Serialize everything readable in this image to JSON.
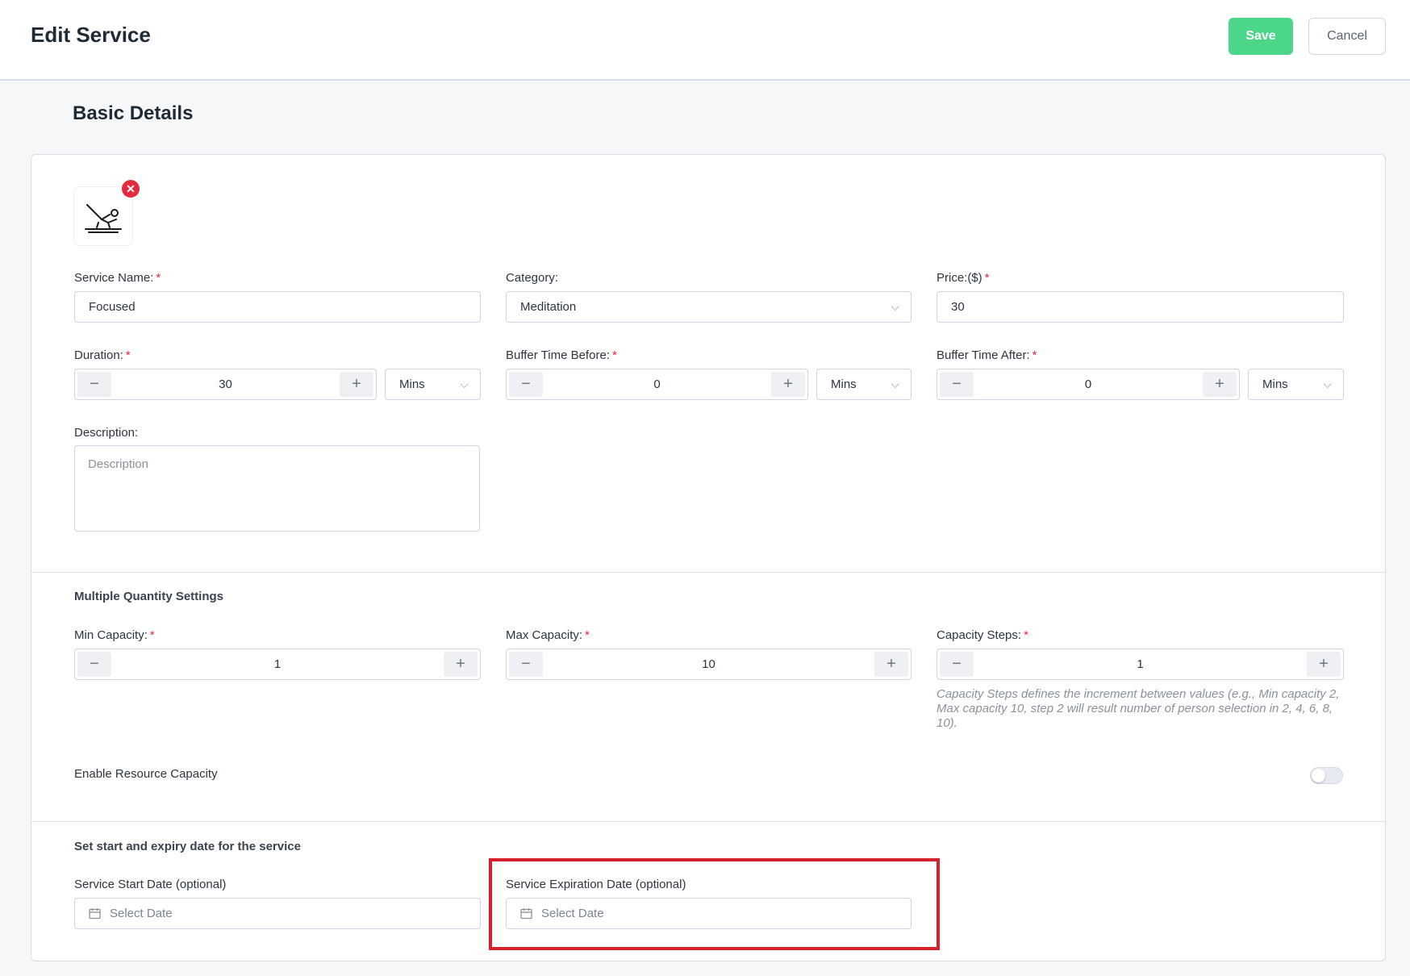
{
  "header": {
    "title": "Edit Service",
    "save_label": "Save",
    "cancel_label": "Cancel"
  },
  "basic_details": {
    "heading": "Basic Details",
    "service_name": {
      "label": "Service Name:",
      "value": "Focused"
    },
    "category": {
      "label": "Category:",
      "value": "Meditation"
    },
    "price": {
      "label": "Price:($)",
      "value": "30"
    },
    "duration": {
      "label": "Duration:",
      "value": "30",
      "unit": "Mins"
    },
    "buffer_before": {
      "label": "Buffer Time Before:",
      "value": "0",
      "unit": "Mins"
    },
    "buffer_after": {
      "label": "Buffer Time After:",
      "value": "0",
      "unit": "Mins"
    },
    "description": {
      "label": "Description:",
      "placeholder": "Description"
    }
  },
  "quantity": {
    "heading": "Multiple Quantity Settings",
    "min_capacity": {
      "label": "Min Capacity:",
      "value": "1"
    },
    "max_capacity": {
      "label": "Max Capacity:",
      "value": "10"
    },
    "capacity_steps": {
      "label": "Capacity Steps:",
      "value": "1"
    },
    "hint": "Capacity Steps defines the increment between values (e.g., Min capacity 2, Max capacity 10, step 2 will result number of person selection in 2, 4, 6, 8, 10).",
    "resource_capacity_label": "Enable Resource Capacity",
    "resource_capacity_enabled": false
  },
  "dates": {
    "heading": "Set start and expiry date for the service",
    "start": {
      "label": "Service Start Date (optional)",
      "placeholder": "Select Date"
    },
    "expiry": {
      "label": "Service Expiration Date (optional)",
      "placeholder": "Select Date"
    }
  },
  "glyphs": {
    "required": "*",
    "minus": "−",
    "plus": "+",
    "remove": "✕",
    "chevron": "⌵"
  },
  "colors": {
    "save_green": "#4cd68a",
    "required_red": "#e5293e",
    "highlight_red": "#d6202c"
  }
}
